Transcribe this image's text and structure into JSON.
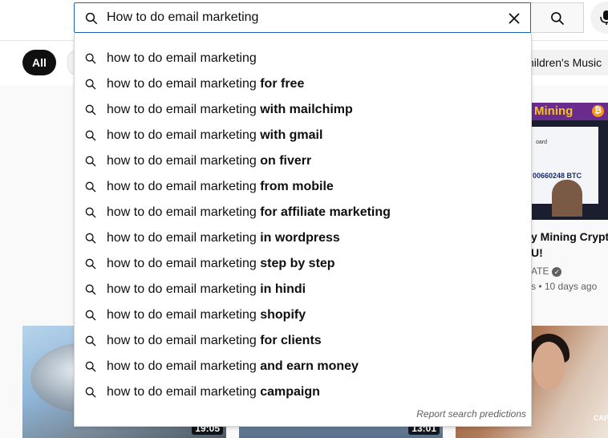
{
  "search": {
    "query": "How to do email marketing",
    "report_label": "Report search predictions",
    "suggestions": [
      {
        "base": "how to do email marketing",
        "bold": ""
      },
      {
        "base": "how to do email marketing",
        "bold": "for free"
      },
      {
        "base": "how to do email marketing",
        "bold": "with mailchimp"
      },
      {
        "base": "how to do email marketing",
        "bold": "with gmail"
      },
      {
        "base": "how to do email marketing",
        "bold": "on fiverr"
      },
      {
        "base": "how to do email marketing",
        "bold": "from mobile"
      },
      {
        "base": "how to do email marketing",
        "bold": "for affiliate marketing"
      },
      {
        "base": "how to do email marketing",
        "bold": "in wordpress"
      },
      {
        "base": "how to do email marketing",
        "bold": "step by step"
      },
      {
        "base": "how to do email marketing",
        "bold": "in hindi"
      },
      {
        "base": "how to do email marketing",
        "bold": "shopify"
      },
      {
        "base": "how to do email marketing",
        "bold": "for clients"
      },
      {
        "base": "how to do email marketing",
        "bold": "and earn money"
      },
      {
        "base": "how to do email marketing",
        "bold": "campaign"
      }
    ]
  },
  "chips": {
    "all": "All",
    "children": "hildren's Music"
  },
  "feed": {
    "right_card": {
      "thumb_banner": "Mining",
      "thumb_coin": "₿",
      "thumb_label": "oard",
      "thumb_btc": "00660248 BTC",
      "title": "y Mining Crypto\nU!",
      "channel": "ATE",
      "meta": "s • 10 days ago"
    },
    "durations": [
      "19:05",
      "13:01"
    ],
    "thumb_c_caption": "CAP"
  },
  "icons": {
    "search": "search-icon",
    "clear": "close-icon",
    "mic": "microphone-icon",
    "verified": "verified-check-icon"
  }
}
